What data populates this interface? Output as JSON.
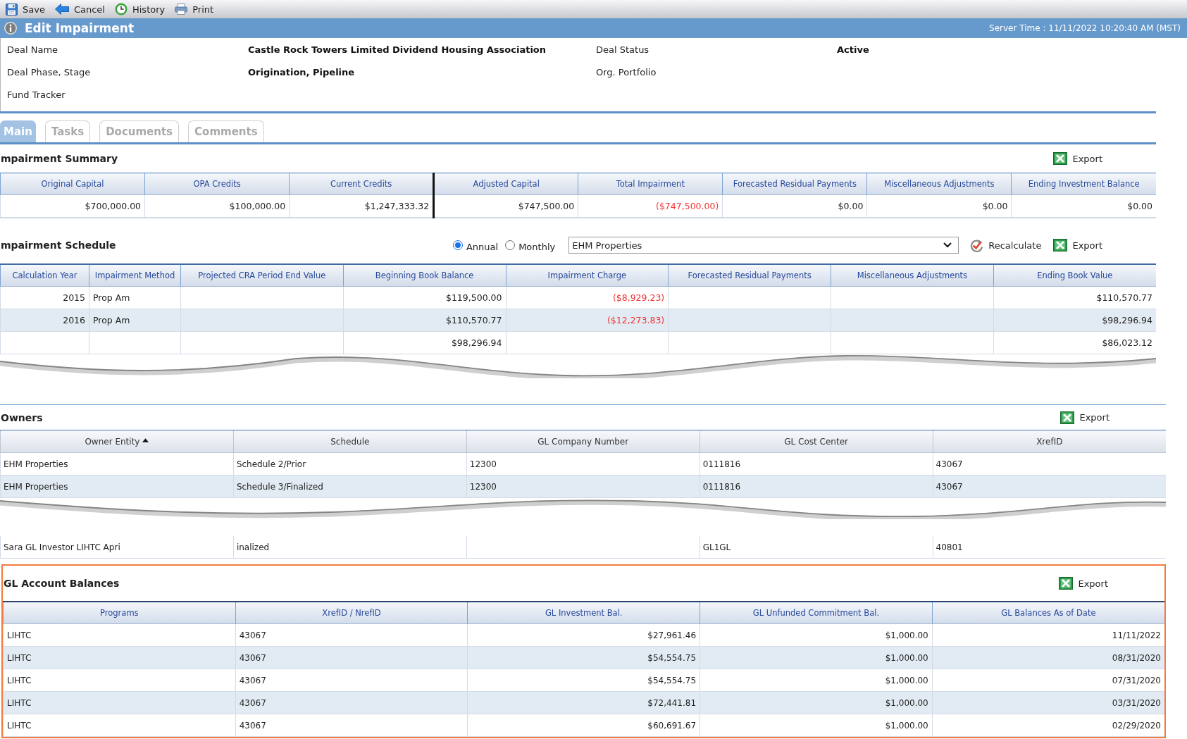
{
  "toolbar": [
    {
      "kind": "save",
      "label": "Save"
    },
    {
      "kind": "cancel",
      "label": "Cancel"
    },
    {
      "kind": "history",
      "label": "History"
    },
    {
      "kind": "print",
      "label": "Print"
    }
  ],
  "title_bar": {
    "title": "Edit Impairment",
    "server_time": "Server Time : 11/11/2022 10:20:40 AM (MST)"
  },
  "deal_info": [
    {
      "label": "Deal Name",
      "value": "Castle Rock Towers Limited Dividend Housing Association"
    },
    {
      "label": "Deal Status",
      "value": "Active"
    },
    {
      "label": "Deal Phase, Stage",
      "value": "Origination, Pipeline"
    },
    {
      "label": "Org. Portfolio"
    },
    {
      "label": "Fund Tracker"
    }
  ],
  "tabs": [
    {
      "label": "Main",
      "selected": true
    },
    {
      "label": "Tasks",
      "selected": false
    },
    {
      "label": "Documents",
      "selected": false
    },
    {
      "label": "Comments",
      "selected": false
    }
  ],
  "impairment_summary": {
    "title": "mpairment Summary",
    "export_label": "Export",
    "columns": [
      {
        "label": "Original Capital",
        "kind": "number"
      },
      {
        "label": "OPA Credits",
        "kind": "number"
      },
      {
        "label": "Current Credits",
        "kind": "number"
      },
      {
        "label": "Adjusted Capital",
        "kind": "number"
      },
      {
        "label": "Total Impairment",
        "kind": "negative"
      },
      {
        "label": "Forecasted Residual Payments",
        "kind": "number"
      },
      {
        "label": "Miscellaneous Adjustments",
        "kind": "number"
      },
      {
        "label": "Ending Investment Balance",
        "kind": "number"
      }
    ],
    "rows": [
      [
        "$700,000.00",
        "$100,000.00",
        "$1,247,333.32",
        "$747,500.00",
        "($747,500.00)",
        "$0.00",
        "$0.00",
        "$0.00"
      ]
    ]
  },
  "impairment_schedule": {
    "title": "mpairment Schedule",
    "periods": [
      {
        "label": "Annual",
        "selected": true
      },
      {
        "label": "Monthly",
        "selected": false
      }
    ],
    "property_select": {
      "value": "EHM Properties"
    },
    "recalculate_label": "Recalculate",
    "export_label": "Export",
    "columns": [
      {
        "label": "Calculation Year",
        "kind": "number"
      },
      {
        "label": "Impairment Method",
        "kind": "text"
      },
      {
        "label": "Projected CRA Period End Value",
        "kind": "number"
      },
      {
        "label": "Beginning Book Balance",
        "kind": "number"
      },
      {
        "label": "Impairment Charge",
        "kind": "negative"
      },
      {
        "label": "Forecasted Residual Payments",
        "kind": "number"
      },
      {
        "label": "Miscellaneous Adjustments",
        "kind": "number"
      },
      {
        "label": "Ending Book Value",
        "kind": "number"
      }
    ],
    "rows": [
      {
        "calculation_year": "2015",
        "impairment_method": "Prop Am",
        "beginning_book_balance": "$119,500.00",
        "impairment_charge": "($8,929.23)",
        "ending_book_value": "$110,570.77"
      },
      {
        "calculation_year": "2016",
        "impairment_method": "Prop Am",
        "beginning_book_balance": "$110,570.77",
        "impairment_charge": "($12,273.83)",
        "ending_book_value": "$98,296.94"
      },
      {
        "beginning_book_balance": "$98,296.94",
        "ending_book_value": "$86,023.12"
      }
    ]
  },
  "owners": {
    "title": "Owners",
    "export_label": "Export",
    "columns": [
      {
        "label": "Owner Entity",
        "sorted": true
      },
      {
        "label": "Schedule",
        "sorted": false
      },
      {
        "label": "GL Company Number",
        "sorted": false
      },
      {
        "label": "GL Cost Center",
        "sorted": false
      },
      {
        "label": "XrefID",
        "sorted": false
      }
    ],
    "rows": [
      {
        "owner_entity": "EHM Properties",
        "schedule": "Schedule 2/Prior",
        "gl_company_number": "12300",
        "gl_cost_center": "0111816",
        "xrefid": "43067"
      },
      {
        "owner_entity": "EHM Properties",
        "schedule": "Schedule 3/Finalized",
        "gl_company_number": "12300",
        "gl_cost_center": "0111816",
        "xrefid": "43067"
      }
    ],
    "rows_after_break": [
      {
        "owner_entity": "Sara GL Investor LIHTC Apri",
        "schedule": "inalized",
        "gl_cost_center": "GL1GL",
        "xrefid": "40801"
      }
    ]
  },
  "gl_account_balances": {
    "title": "GL Account Balances",
    "highlighted": true,
    "export_label": "Export",
    "columns": [
      {
        "label": "Programs",
        "kind": "text"
      },
      {
        "label": "XrefID / NrefID",
        "kind": "text"
      },
      {
        "label": "GL Investment Bal.",
        "kind": "number"
      },
      {
        "label": "GL Unfunded Commitment Bal.",
        "kind": "number"
      },
      {
        "label": "GL Balances As of Date",
        "kind": "number"
      }
    ],
    "rows": [
      [
        "LIHTC",
        "43067",
        "$27,961.46",
        "$1,000.00",
        "11/11/2022"
      ],
      [
        "LIHTC",
        "43067",
        "$54,554.75",
        "$1,000.00",
        "08/31/2020"
      ],
      [
        "LIHTC",
        "43067",
        "$54,554.75",
        "$1,000.00",
        "07/31/2020"
      ],
      [
        "LIHTC",
        "43067",
        "$72,441.81",
        "$1,000.00",
        "03/31/2020"
      ],
      [
        "LIHTC",
        "43067",
        "$60,691.67",
        "$1,000.00",
        "02/29/2020"
      ]
    ]
  }
}
